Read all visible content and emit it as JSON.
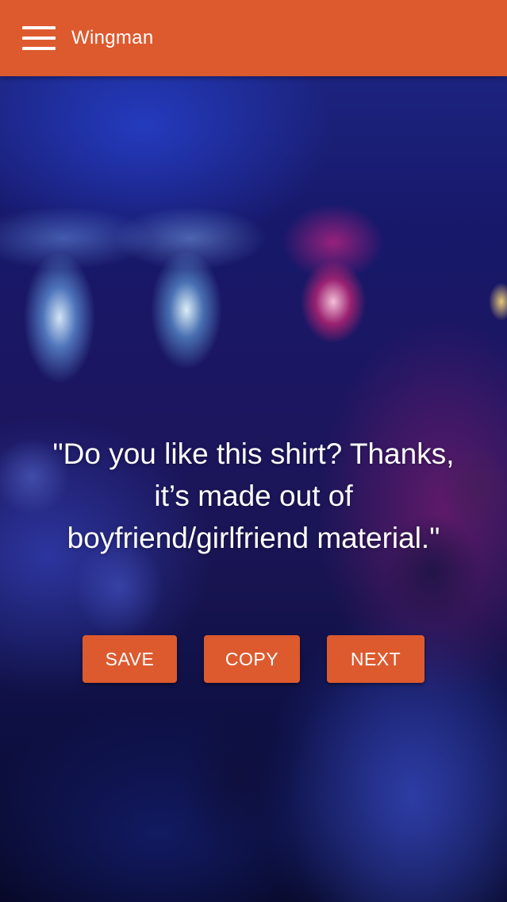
{
  "app": {
    "title": "Wingman",
    "accent_color": "#dd5a2f"
  },
  "header": {
    "menu_icon": "hamburger-menu-icon"
  },
  "main": {
    "quote": "\"Do you like this shirt? Thanks, it’s made out of boyfriend/girlfriend material.\""
  },
  "actions": {
    "save_label": "SAVE",
    "copy_label": "COPY",
    "next_label": "NEXT"
  }
}
